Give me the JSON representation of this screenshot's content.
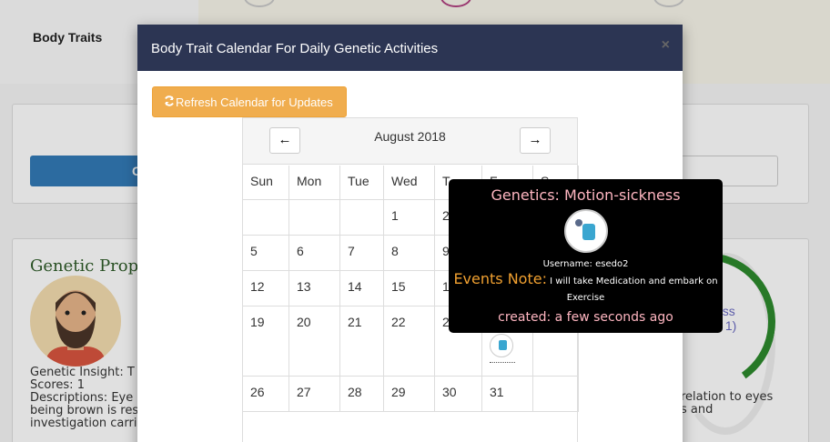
{
  "background": {
    "section_title": "Body Traits",
    "button_partial": "C",
    "card_heading": "Genetic Prop",
    "insight_line": "Genetic Insight: T",
    "scores_line": "Scores: 1",
    "description_line1": "Descriptions: Eye",
    "description_line2": "being brown is res",
    "description_line3": "investigation carri",
    "gauge_line1": "-",
    "gauge_line2": "ess",
    "gauge_line3": "s 1)",
    "right_text_line1": "relation to eyes",
    "right_text_line2": "s and"
  },
  "modal": {
    "title": "Body Trait Calendar For Daily Genetic Activities",
    "close_label": "×",
    "refresh_label": "Refresh Calendar for Updates"
  },
  "calendar": {
    "month_label": "August 2018",
    "prev_icon": "←",
    "next_icon": "→",
    "weekdays": [
      "Sun",
      "Mon",
      "Tue",
      "Wed",
      "T",
      "F",
      "S"
    ],
    "weeks": [
      [
        "",
        "",
        "",
        "1",
        "2",
        "",
        ""
      ],
      [
        "5",
        "6",
        "7",
        "8",
        "9",
        "",
        ""
      ],
      [
        "12",
        "13",
        "14",
        "15",
        "1",
        "",
        ""
      ],
      [
        "19",
        "20",
        "21",
        "22",
        "2",
        "",
        ""
      ],
      [
        "26",
        "27",
        "28",
        "29",
        "30",
        "31",
        ""
      ]
    ]
  },
  "tooltip": {
    "title": "Genetics: Motion-sickness",
    "username": "Username: esedo2",
    "note_label": "Events Note:",
    "note_text": " I will take Medication and embark on Exercise",
    "created": "created: a few seconds ago"
  }
}
